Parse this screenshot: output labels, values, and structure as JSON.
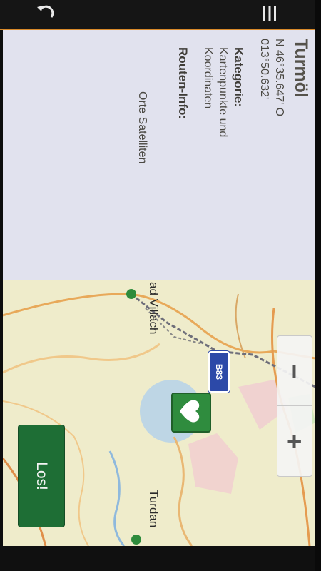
{
  "detail": {
    "title": "Turmöl",
    "coord_line1": "N 46°35.647' O",
    "coord_line2": "013°50.632'",
    "category_label": "Kategorie:",
    "category_line1": "Kartenpunkte und",
    "category_line2": "Koordinaten",
    "route_info_label": "Routen-Info:",
    "route_info_value": "Orte Satelliten"
  },
  "map": {
    "place_villach": "ad Villach",
    "place_turdan": "Turdan",
    "road_shield": "B83"
  },
  "actions": {
    "go_label": "Los!",
    "zoom_in_label": "+",
    "zoom_out_label": "−"
  },
  "icons": {
    "back": "back-arrow-icon",
    "menu": "menu-icon",
    "favorite": "heart-favorite-icon"
  },
  "colors": {
    "accent": "#d98a2a",
    "go_button": "#1e6e35",
    "shield": "#2c49a8",
    "marker": "#2e8b3c"
  }
}
